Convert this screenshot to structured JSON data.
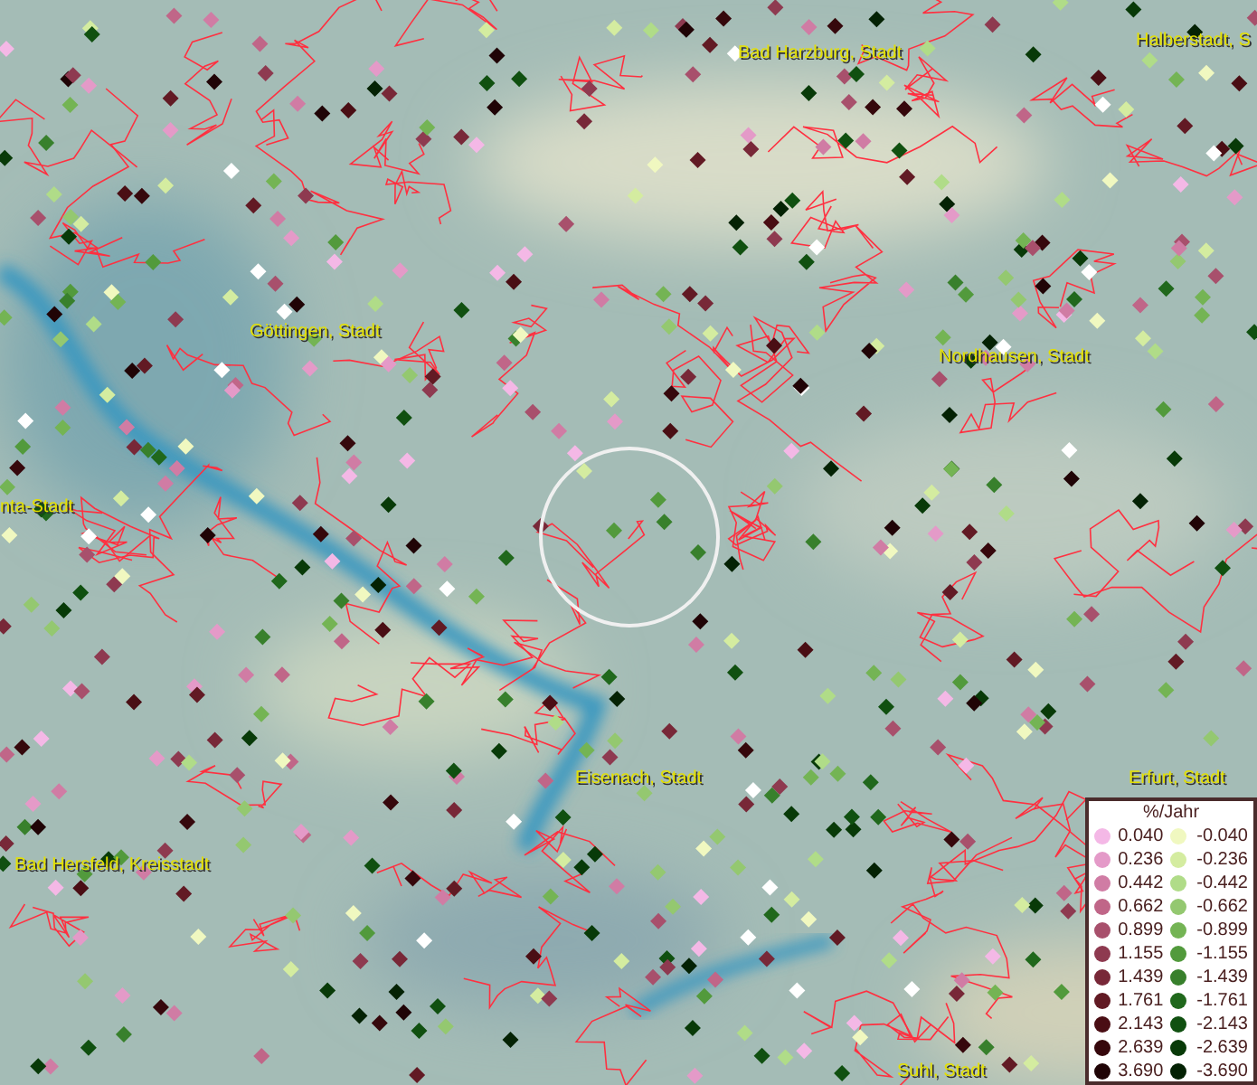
{
  "map": {
    "place_labels": [
      {
        "text": "Bad Harzburg, Stadt"
      },
      {
        "text": "Halberstadt, S"
      },
      {
        "text": "Göttingen, Stadt"
      },
      {
        "text": "Nordhausen, Stadt"
      },
      {
        "text": "nta-Stadt"
      },
      {
        "text": "Eisenach, Stadt"
      },
      {
        "text": "Erfurt, Stadt"
      },
      {
        "text": "Bad Hersfeld, Kreisstadt"
      },
      {
        "text": "Suhl, Stadt"
      }
    ]
  },
  "legend": {
    "title": "%/Jahr",
    "rows": [
      {
        "positive": {
          "label": "0.040",
          "color": "#f4b8e6"
        },
        "negative": {
          "label": "-0.040",
          "color": "#f0f8c0"
        }
      },
      {
        "positive": {
          "label": "0.236",
          "color": "#e49ac8"
        },
        "negative": {
          "label": "-0.236",
          "color": "#d4eca0"
        }
      },
      {
        "positive": {
          "label": "0.442",
          "color": "#d07ca4"
        },
        "negative": {
          "label": "-0.442",
          "color": "#b0dc88"
        }
      },
      {
        "positive": {
          "label": "0.662",
          "color": "#c06688"
        },
        "negative": {
          "label": "-0.662",
          "color": "#94c870"
        }
      },
      {
        "positive": {
          "label": "0.899",
          "color": "#a8506c"
        },
        "negative": {
          "label": "-0.899",
          "color": "#74b454"
        }
      },
      {
        "positive": {
          "label": "1.155",
          "color": "#8e3a50"
        },
        "negative": {
          "label": "-1.155",
          "color": "#529a3c"
        }
      },
      {
        "positive": {
          "label": "1.439",
          "color": "#782838"
        },
        "negative": {
          "label": "-1.439",
          "color": "#38802c"
        }
      },
      {
        "positive": {
          "label": "1.761",
          "color": "#621a24"
        },
        "negative": {
          "label": "-1.761",
          "color": "#20681c"
        }
      },
      {
        "positive": {
          "label": "2.143",
          "color": "#4a0e14"
        },
        "negative": {
          "label": "-2.143",
          "color": "#105010"
        }
      },
      {
        "positive": {
          "label": "2.639",
          "color": "#36080c"
        },
        "negative": {
          "label": "-2.639",
          "color": "#083a08"
        }
      },
      {
        "positive": {
          "label": "3.690",
          "color": "#200406"
        },
        "negative": {
          "label": "-3.690",
          "color": "#042204"
        }
      }
    ]
  }
}
